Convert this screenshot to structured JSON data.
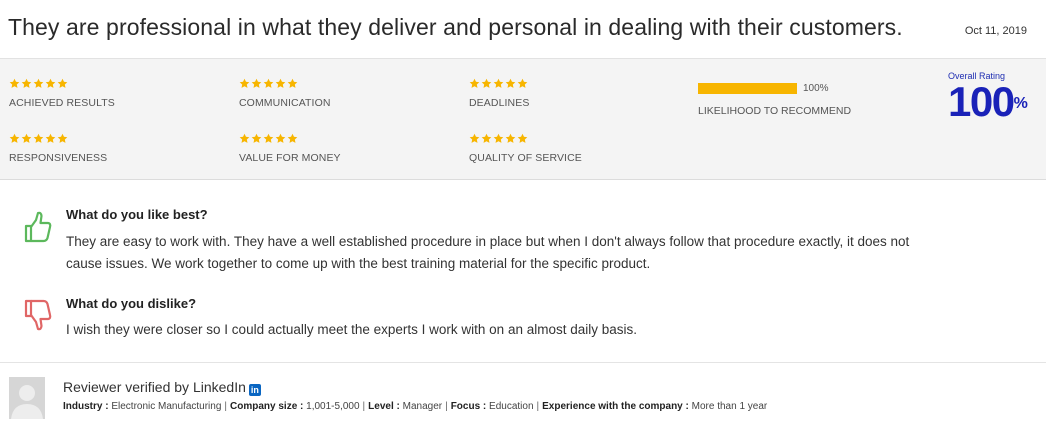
{
  "review": {
    "title": "They are professional in what they deliver and personal in dealing with their customers.",
    "date": "Oct 11, 2019"
  },
  "ratings": [
    {
      "label": "ACHIEVED RESULTS",
      "stars": 5
    },
    {
      "label": "COMMUNICATION",
      "stars": 5
    },
    {
      "label": "DEADLINES",
      "stars": 5
    },
    {
      "label": "RESPONSIVENESS",
      "stars": 5
    },
    {
      "label": "VALUE FOR MONEY",
      "stars": 5
    },
    {
      "label": "QUALITY OF SERVICE",
      "stars": 5
    }
  ],
  "recommend": {
    "percent_text": "100%",
    "fill_fraction": 1.0,
    "label": "LIKELIHOOD TO RECOMMEND"
  },
  "overall": {
    "label": "Overall Rating",
    "value": "100",
    "unit": "%"
  },
  "like": {
    "question": "What do you like best?",
    "answer": "They are easy to work with. They have a well established procedure in place but when I don't always follow that procedure exactly, it does not cause issues. We work together to come up with the best training material for the specific product."
  },
  "dislike": {
    "question": "What do you dislike?",
    "answer": "I wish they were closer so I could actually meet the experts I work with on an almost daily basis."
  },
  "reviewer": {
    "verified_text": "Reviewer verified by LinkedIn",
    "linkedin_glyph": "in",
    "fields": [
      {
        "key": "Industry :",
        "value": "Electronic Manufacturing"
      },
      {
        "key": "Company size :",
        "value": "1,001-5,000"
      },
      {
        "key": "Level :",
        "value": "Manager"
      },
      {
        "key": "Focus :",
        "value": "Education"
      },
      {
        "key": "Experience with the company :",
        "value": "More than 1 year"
      }
    ],
    "separator": "|"
  },
  "colors": {
    "star": "#f7b500",
    "bar": "#f7b500",
    "overall": "#1a22b8",
    "thumbs_up": "#5cb85c",
    "thumbs_down": "#e06666",
    "linkedin": "#0a66c2"
  },
  "icons": {
    "star": "star-icon",
    "like": "thumbs-up-icon",
    "dislike": "thumbs-down-icon",
    "avatar": "user-avatar-placeholder",
    "linkedin": "linkedin-icon"
  }
}
